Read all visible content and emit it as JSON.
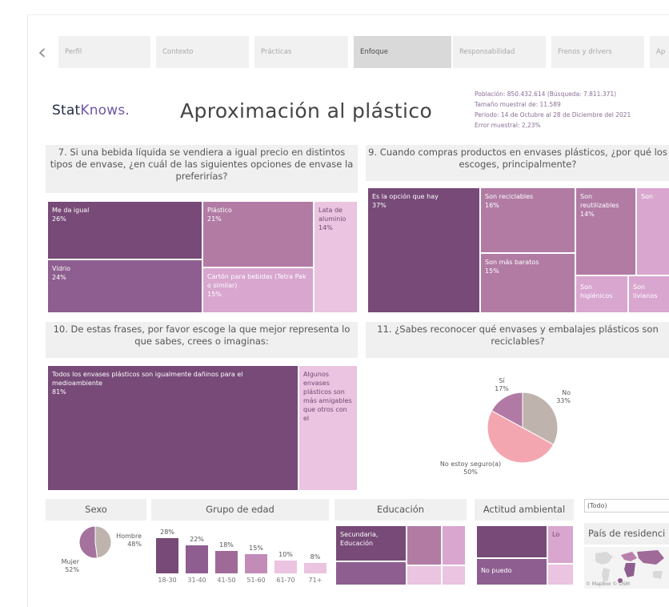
{
  "tabs": [
    "Perfil",
    "Contexto",
    "Prácticas",
    "Enfoque",
    "Responsabilidad",
    "Frenos y drivers",
    "Ap"
  ],
  "logo": {
    "part1": "Stat",
    "part2": "Knows."
  },
  "title": "Aproximación al plástico",
  "info": {
    "line1": "Población: 850.432.614 (Búsqueda: 7.811.371)",
    "line2": "Tamaño muestral de: 11.589",
    "line3": "Periodo: 14 de Octubre al 28 de Diciembre del 2021",
    "line4": "Error muestral: 2,23%"
  },
  "q7": {
    "question": "7. Si una bebida líquida se vendiera a igual precio en distintos tipos de envase, ¿en cuál de las siguientes opciones de envase la preferirías?",
    "cells": [
      {
        "label": "Me da igual",
        "value": "26%"
      },
      {
        "label": "Plástico",
        "value": "21%"
      },
      {
        "label": "Lata de aluminio",
        "value": "14%"
      },
      {
        "label": "Vidrio",
        "value": "24%"
      },
      {
        "label": "Cartón para bebidas (Tetra Pak o similar)",
        "value": "15%"
      }
    ]
  },
  "q9": {
    "question": "9. Cuando compras productos en envases plásticos, ¿por qué los escoges, principalmente?",
    "cells": [
      {
        "label": "Es la opción que hay",
        "value": "37%"
      },
      {
        "label": "Son reciclables",
        "value": "16%"
      },
      {
        "label": "Son reutilizables",
        "value": "14%"
      },
      {
        "label": "Son",
        "value": ""
      },
      {
        "label": "Son más baratos",
        "value": "15%"
      },
      {
        "label": "Son higiénicos",
        "value": ""
      },
      {
        "label": "Son livianos",
        "value": ""
      }
    ]
  },
  "q10": {
    "question": "10. De estas frases, por favor escoge la que mejor representa lo que sabes, crees o imaginas:",
    "cells": [
      {
        "label": "Todos los envases plásticos son igualmente dañinos para el medioambiente",
        "value": "81%"
      },
      {
        "label": "Algunos envases plásticos son más amigables que otros con el",
        "value": ""
      }
    ]
  },
  "q11": {
    "question": "11. ¿Sabes reconocer qué envases y embalajes plásticos son reciclables?",
    "slices": [
      {
        "label": "Sí",
        "value": "17%",
        "pct": 17,
        "color": "#b07aa4"
      },
      {
        "label": "No",
        "value": "33%",
        "pct": 33,
        "color": "#bfb3ad"
      },
      {
        "label": "No estoy seguro(a)",
        "value": "50%",
        "pct": 50,
        "color": "#f4a6b0"
      }
    ]
  },
  "sexo": {
    "title": "Sexo",
    "slices": [
      {
        "label": "Hombre",
        "value": "48%",
        "pct": 48,
        "color": "#bfb3ad"
      },
      {
        "label": "Mujer",
        "value": "52%",
        "pct": 52,
        "color": "#a5729e"
      }
    ]
  },
  "edad": {
    "title": "Grupo de edad",
    "categories": [
      "18-30",
      "31-40",
      "41-50",
      "51-60",
      "61-70",
      "71+"
    ],
    "values": [
      28,
      22,
      18,
      15,
      10,
      8
    ],
    "labels": [
      "28%",
      "22%",
      "18%",
      "15%",
      "10%",
      "8%"
    ]
  },
  "educacion": {
    "title": "Educación",
    "cell_label": "Secundaria, Educación"
  },
  "actitud": {
    "title": "Actitud ambiental",
    "cells": [
      "Lo",
      "No puedo"
    ]
  },
  "filter": {
    "value": "(Todo)"
  },
  "pais": {
    "title": "País de residenci",
    "attribution": "© Mapbox © OSM"
  },
  "colors": {
    "dark": "#774a77",
    "mid": "#8d5e8f",
    "rose": "#b17ba4",
    "light": "#eac4e0"
  }
}
